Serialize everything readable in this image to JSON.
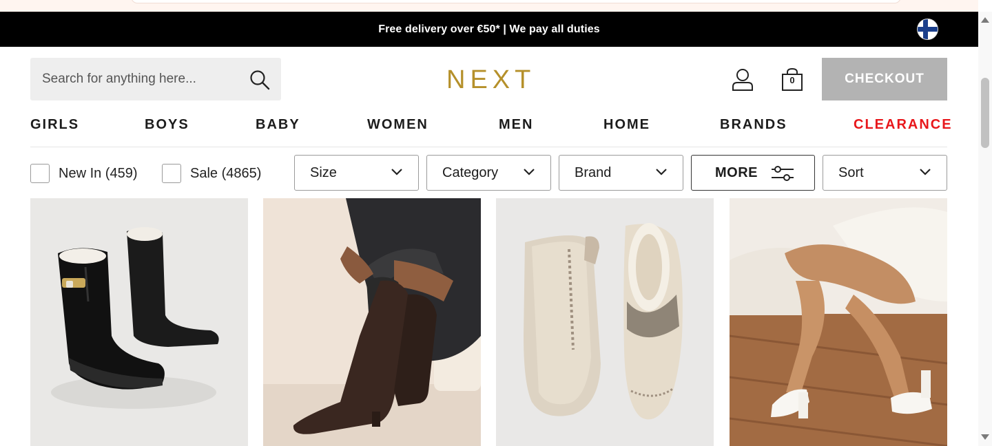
{
  "promo": {
    "text": "Free delivery over €50* | We pay all duties",
    "flag": "finland-flag-icon"
  },
  "header": {
    "search_placeholder": "Search for anything here...",
    "logo": "NEXT",
    "bag_count": "0",
    "checkout_label": "CHECKOUT"
  },
  "nav": {
    "items": [
      {
        "label": "GIRLS"
      },
      {
        "label": "BOYS"
      },
      {
        "label": "BABY"
      },
      {
        "label": "WOMEN"
      },
      {
        "label": "MEN"
      },
      {
        "label": "HOME"
      },
      {
        "label": "BRANDS"
      },
      {
        "label": "CLEARANCE",
        "color": "#e8171b"
      }
    ]
  },
  "filters": {
    "new_in": "New In (459)",
    "sale": "Sale (4865)",
    "size": "Size",
    "category": "Category",
    "brand": "Brand",
    "more": "MORE",
    "sort": "Sort"
  },
  "products": [
    {
      "image": "black-wellington-boots-image"
    },
    {
      "image": "brown-knee-high-boots-image"
    },
    {
      "image": "cream-platform-slippers-image"
    },
    {
      "image": "white-block-heel-sandals-image"
    }
  ],
  "colors": {
    "accent": "#b5902a",
    "clearance": "#e8171b",
    "promo_bg": "#000000",
    "checkout_bg": "#b3b3b3"
  }
}
